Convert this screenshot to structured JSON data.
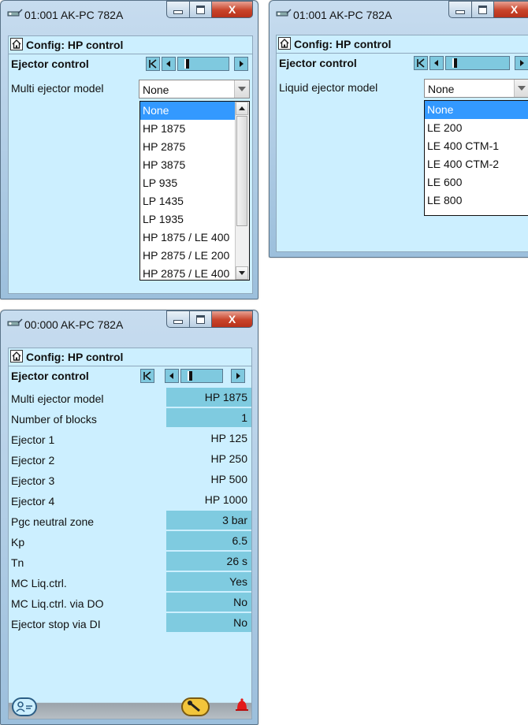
{
  "win1": {
    "title": "01:001 AK-PC 782A",
    "close": "X",
    "header": "Config: HP control",
    "section": "Ejector control",
    "field_label": "Multi ejector model",
    "field_value": "None",
    "options": [
      "None",
      "HP 1875",
      "HP 2875",
      "HP 3875",
      "LP 935",
      "LP 1435",
      "LP 1935",
      "HP 1875 / LE 400",
      "HP 2875 / LE 200",
      "HP 2875 / LE 400"
    ]
  },
  "win2": {
    "title": "01:001 AK-PC 782A",
    "close": "X",
    "header": "Config: HP control",
    "section": "Ejector control",
    "field_label": "Liquid ejector model",
    "field_value": "None",
    "options": [
      "None",
      "LE 200",
      "LE 400 CTM-1",
      "LE 400 CTM-2",
      "LE 600",
      "LE 800"
    ]
  },
  "win3": {
    "title": "00:000 AK-PC 782A",
    "close": "X",
    "header": "Config: HP control",
    "section": "Ejector control",
    "rows": [
      {
        "label": "Multi ejector model",
        "value": "HP 1875",
        "editable": true
      },
      {
        "label": "Number of blocks",
        "value": "1",
        "editable": true
      },
      {
        "label": "Ejector 1",
        "value": "HP 125",
        "editable": false
      },
      {
        "label": "Ejector 2",
        "value": "HP 250",
        "editable": false
      },
      {
        "label": "Ejector 3",
        "value": "HP 500",
        "editable": false
      },
      {
        "label": "Ejector 4",
        "value": "HP 1000",
        "editable": false
      },
      {
        "label": "Pgc neutral zone",
        "value": "3 bar",
        "editable": true
      },
      {
        "label": "Kp",
        "value": "6.5",
        "editable": true
      },
      {
        "label": "Tn",
        "value": "26 s",
        "editable": true
      },
      {
        "label": "MC Liq.ctrl.",
        "value": "Yes",
        "editable": true
      },
      {
        "label": "MC Liq.ctrl. via DO",
        "value": "No",
        "editable": true
      },
      {
        "label": "Ejector stop via DI",
        "value": "No",
        "editable": true
      }
    ],
    "footer_icons": [
      "user-icon",
      "wrench-icon",
      "alarm-bell-icon"
    ]
  },
  "colors": {
    "panel": "#ccefff",
    "edit_field": "#7fcbe0",
    "selection": "#3399ff",
    "close_button": "#c8442a"
  }
}
